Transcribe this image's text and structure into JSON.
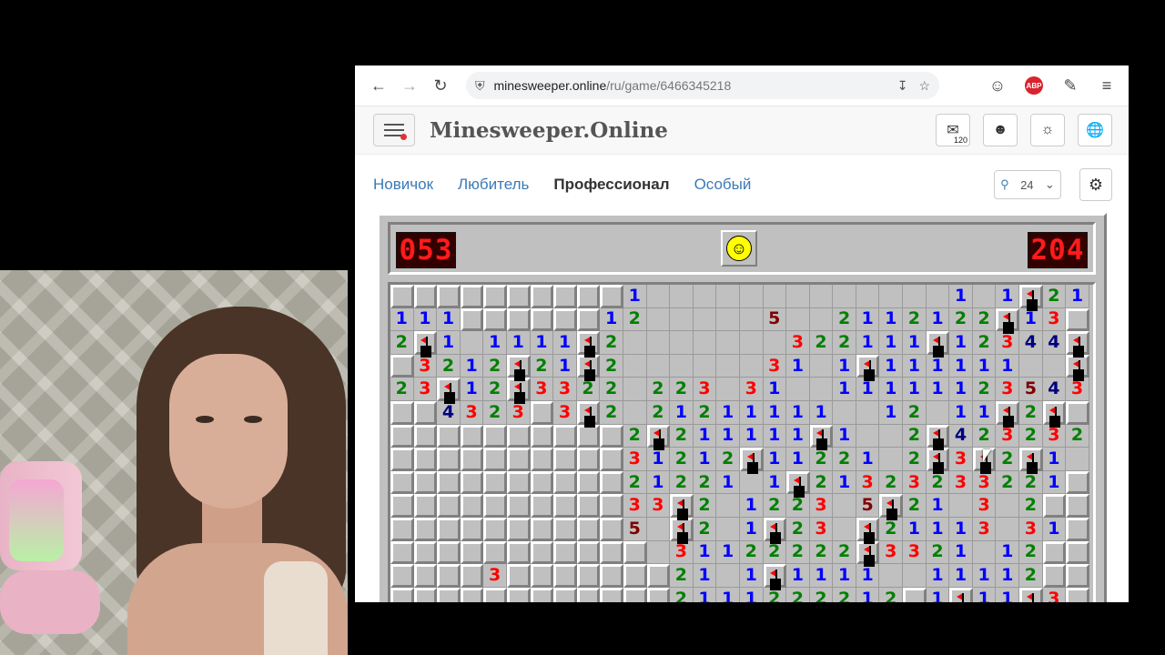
{
  "browser": {
    "url_host": "minesweeper.online",
    "url_path": "/ru/game/6466345218",
    "icons": [
      "back-arrow-icon",
      "forward-arrow-icon",
      "reload-icon",
      "shield-icon",
      "download-icon",
      "star-icon",
      "account-icon",
      "adblock-icon",
      "extensions-icon",
      "menu-icon"
    ],
    "abp_label": "ABP"
  },
  "site": {
    "title": "Minesweeper.Online",
    "mail_count": "120",
    "levels": [
      "Новичок",
      "Любитель",
      "Профессионал",
      "Особый"
    ],
    "active_level": "Профессионал",
    "zoom_value": "24"
  },
  "game": {
    "mines_counter": "053",
    "timer": "204",
    "rows": [
      "hhhhhhhhhh1ooooooooooooo1o1F212h",
      "111hhhhhh12ooooo5oo2112122F13h",
      "2F1o1111F2ooooooo322111F1234 4F",
      "h321 2F21F2oooooo31o1F111111ooF2",
      "23F12F3322o223o31oo11111123543",
      "hh4323h3F2o21211111oo12o11F2Fh",
      "hhhhhhhhhh2F211111F1oo2F42323222",
      "hhhhhhhhhh31212F11221o2F3F2F1oh",
      "hhhhhhhhhh2122 1o1F21323233221",
      "hhhhhhhhhh33F2o1223o5F21o3o2h",
      "hhhhhhhhhh5oF2o1F23oF21113o31",
      "hhhhhhhhhhho31122222F3321o12hh",
      "hhhh3hhhhhhh21o1F1111oo11112hh",
      "hhhhhhhhhhhh2111222212h1F11F3h2"
    ]
  }
}
